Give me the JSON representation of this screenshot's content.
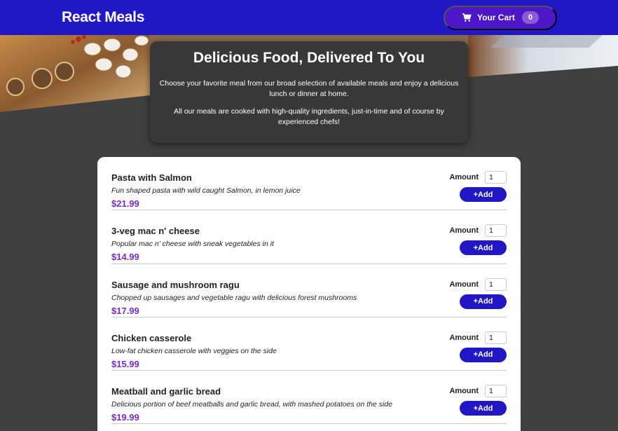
{
  "header": {
    "logo": "React Meals",
    "cart_label": "Your Cart",
    "cart_count": "0",
    "cart_icon": "cart-icon"
  },
  "summary": {
    "title": "Delicious Food, Delivered To You",
    "paragraph1": "Choose your favorite meal from our broad selection of available meals and enjoy a delicious lunch or dinner at home.",
    "paragraph2": "All our meals are cooked with high-quality ingredients, just-in-time and of course by experienced chefs!"
  },
  "meals": [
    {
      "name": "Pasta with Salmon",
      "description": "Fun shaped pasta with wild caught Salmon, in lemon juice",
      "price": "$21.99",
      "amount_label": "Amount",
      "amount_value": "1",
      "add_label": "+Add"
    },
    {
      "name": "3-veg mac n' cheese",
      "description": "Popular mac n' cheese with sneak vegetables in it",
      "price": "$14.99",
      "amount_label": "Amount",
      "amount_value": "1",
      "add_label": "+Add"
    },
    {
      "name": "Sausage and mushroom ragu",
      "description": "Chopped up sausages and vegetable ragu with delicious forest mushrooms",
      "price": "$17.99",
      "amount_label": "Amount",
      "amount_value": "1",
      "add_label": "+Add"
    },
    {
      "name": "Chicken casserole",
      "description": "Low-fat chicken casserole with veggies on the side",
      "price": "$15.99",
      "amount_label": "Amount",
      "amount_value": "1",
      "add_label": "+Add"
    },
    {
      "name": "Meatball and garlic bread",
      "description": "Delicious portion of beef meatballs and garlic bread, with mashed potatoes on the side",
      "price": "$19.99",
      "amount_label": "Amount",
      "amount_value": "1",
      "add_label": "+Add"
    }
  ],
  "colors": {
    "header": "#2117c4",
    "cart_button": "#4d17c8",
    "price": "#7a2ccf",
    "background": "#3f3f3f"
  }
}
